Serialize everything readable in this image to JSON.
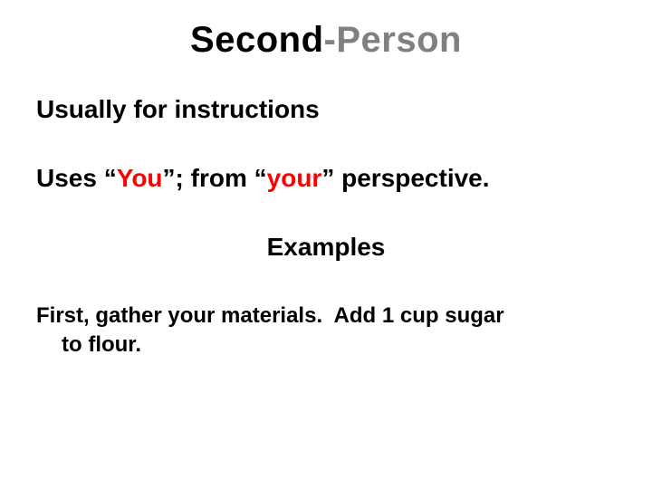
{
  "title": {
    "part1": "Second",
    "dash": "-",
    "part2": "Person"
  },
  "line1": "Usually for instructions",
  "line2": {
    "a": "Uses “",
    "you": "You",
    "b": "”; from “",
    "your": "your",
    "c": "” perspective."
  },
  "examples_heading": "Examples",
  "example": {
    "a": "First, gather ",
    "your": "your",
    "b": " materials.  Add 1 cup sugar",
    "c": "to flour."
  }
}
